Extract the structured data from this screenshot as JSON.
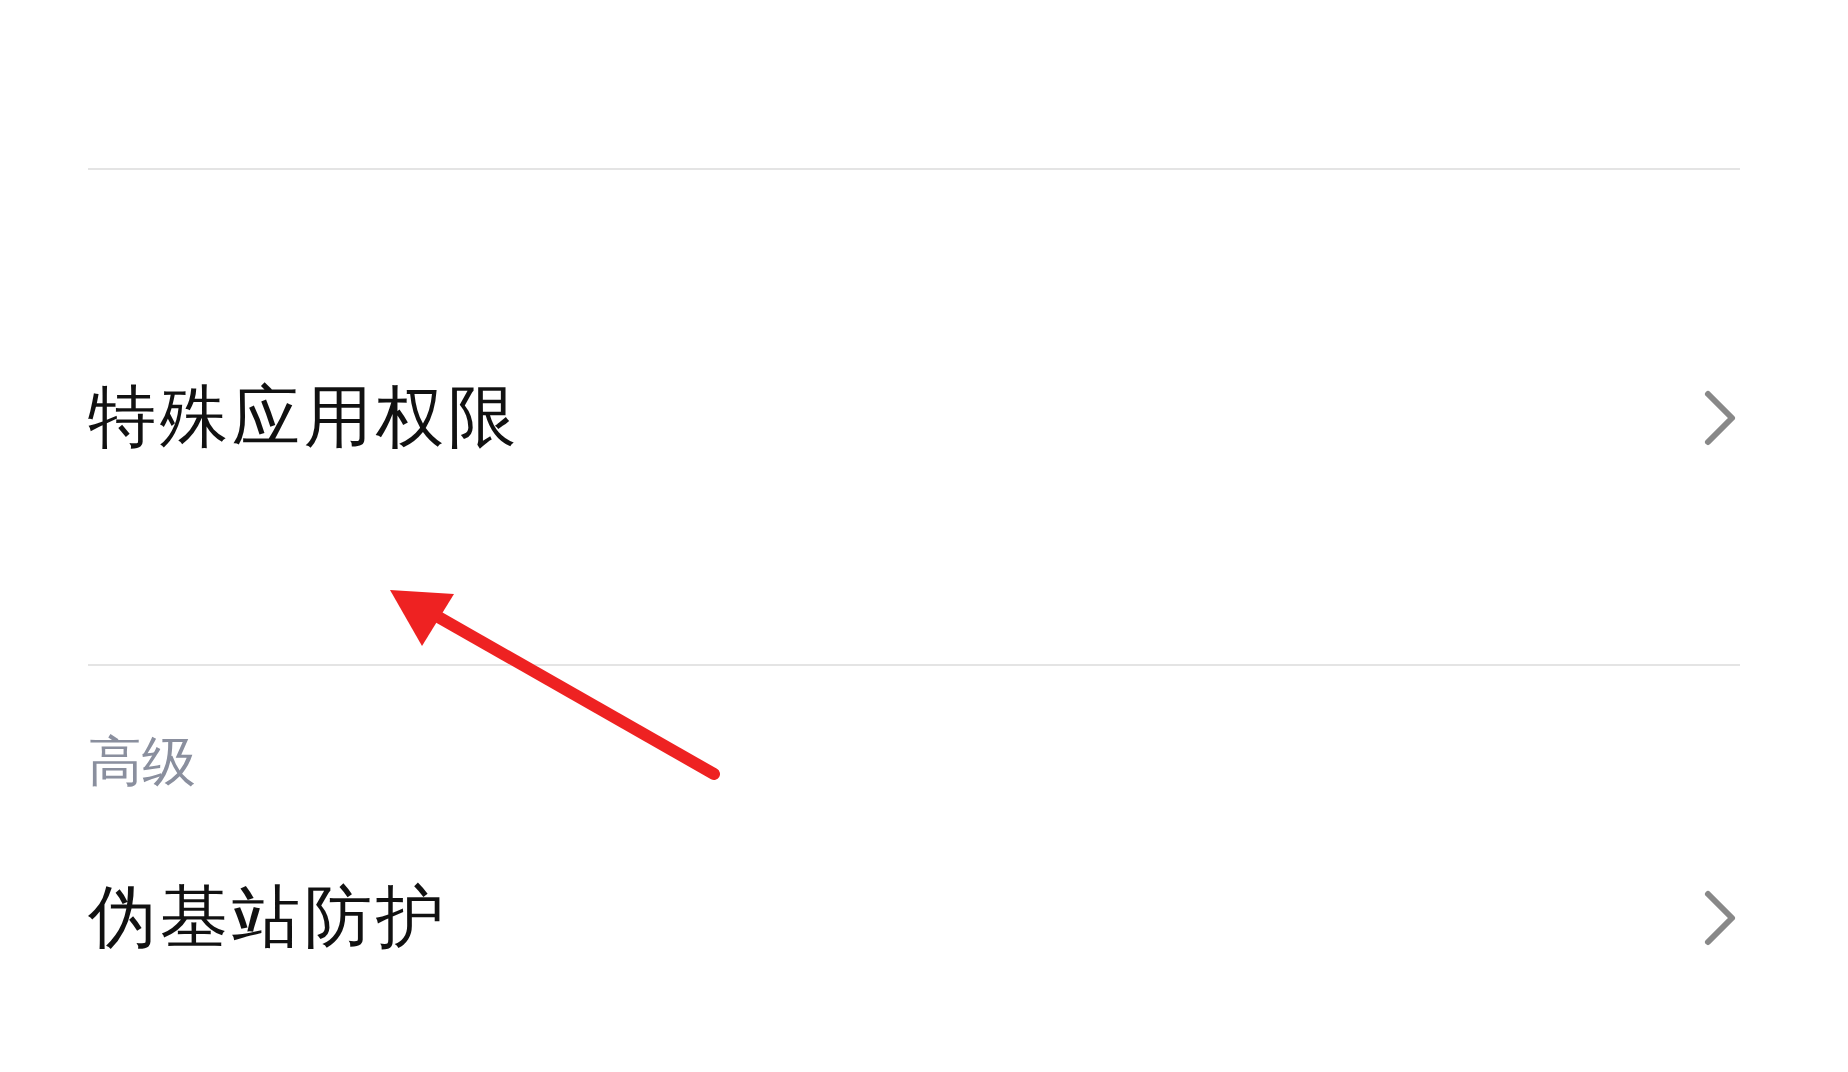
{
  "items": [
    {
      "label": "特殊应用权限"
    }
  ],
  "section": {
    "title": "高级",
    "items": [
      {
        "label": "伪基站防护"
      }
    ]
  }
}
